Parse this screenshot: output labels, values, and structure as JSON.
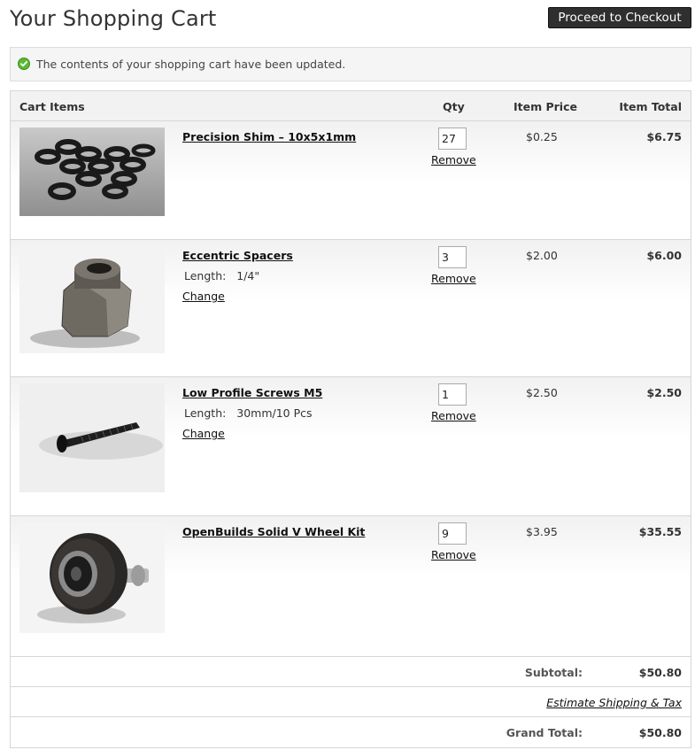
{
  "page": {
    "title": "Your Shopping Cart",
    "checkout_label": "Proceed to Checkout"
  },
  "notice": {
    "icon": "check-circle-icon",
    "message": "The contents of your shopping cart have been updated."
  },
  "cart": {
    "headers": {
      "items": "Cart Items",
      "qty": "Qty",
      "price": "Item Price",
      "total": "Item Total"
    },
    "items": [
      {
        "name": "Precision Shim – 10x5x1mm",
        "qty": "27",
        "remove_label": "Remove",
        "price": "$0.25",
        "total": "$6.75",
        "image": "washers-photo"
      },
      {
        "name": "Eccentric Spacers",
        "option_label": "Length:",
        "option_value": "1/4\"",
        "change_label": "Change",
        "qty": "3",
        "remove_label": "Remove",
        "price": "$2.00",
        "total": "$6.00",
        "image": "hex-spacer-photo"
      },
      {
        "name": "Low Profile Screws M5",
        "option_label": "Length:",
        "option_value": "30mm/10 Pcs",
        "change_label": "Change",
        "qty": "1",
        "remove_label": "Remove",
        "price": "$2.50",
        "total": "$2.50",
        "image": "screw-photo"
      },
      {
        "name": "OpenBuilds Solid V Wheel Kit",
        "qty": "9",
        "remove_label": "Remove",
        "price": "$3.95",
        "total": "$35.55",
        "image": "v-wheel-photo"
      }
    ]
  },
  "summary": {
    "subtotal_label": "Subtotal:",
    "subtotal_value": "$50.80",
    "estimate_label": "Estimate Shipping & Tax",
    "grand_total_label": "Grand Total:",
    "grand_total_value": "$50.80"
  }
}
